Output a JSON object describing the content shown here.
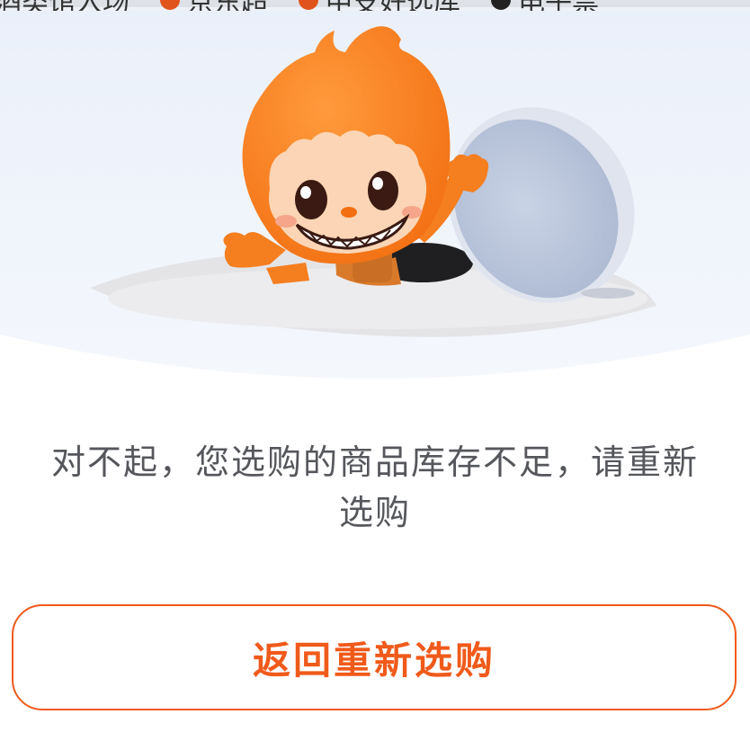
{
  "top_nav": {
    "tabs": [
      {
        "label": "酒类馆入场",
        "icon": "none"
      },
      {
        "label": "京东超",
        "icon": "orange-badge-icon"
      },
      {
        "label": "中支好选库",
        "icon": "orange-badge-icon"
      },
      {
        "label": "电子票",
        "icon": "dark-badge-icon"
      }
    ]
  },
  "illustration": {
    "mascot": "orange-mascot-peeking-from-manhole",
    "accent_color": "#f57e1f",
    "background_color": "#eef3fb"
  },
  "message": {
    "line1": "对不起，您选购的商品库存不足，请重新",
    "line2": "选购"
  },
  "button": {
    "label": "返回重新选购",
    "color": "#f05a1a"
  }
}
